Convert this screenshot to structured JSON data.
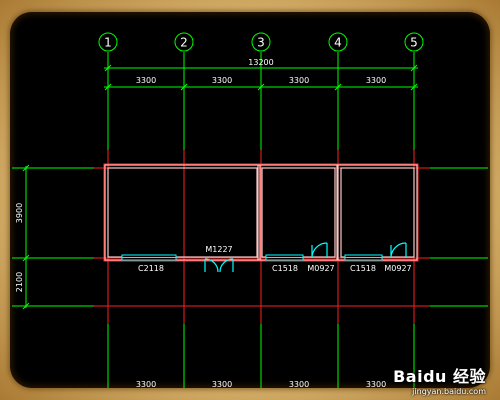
{
  "axes": {
    "labels": [
      "1",
      "2",
      "3",
      "4",
      "5"
    ]
  },
  "dimensions": {
    "total": "13200",
    "spans_top": [
      "3300",
      "3300",
      "3300",
      "3300"
    ],
    "spans_bottom": [
      "3300",
      "3300",
      "3300",
      "3300"
    ],
    "vertical": [
      "3900",
      "2100"
    ]
  },
  "openings": {
    "c2118": "C2118",
    "m1227": "M1227",
    "c1518_a": "C1518",
    "m0927_a": "M0927",
    "c1518_b": "C1518",
    "m0927_b": "M0927"
  },
  "watermark": {
    "brand": "Baidu 经验",
    "url": "jingyan.baidu.com"
  },
  "colors": {
    "grid_green": "#00ff00",
    "wall_red": "#ff3030",
    "wall_outline": "#ffc8c8",
    "window_cyan": "#00ffff",
    "canvas_bg": "#000000"
  }
}
